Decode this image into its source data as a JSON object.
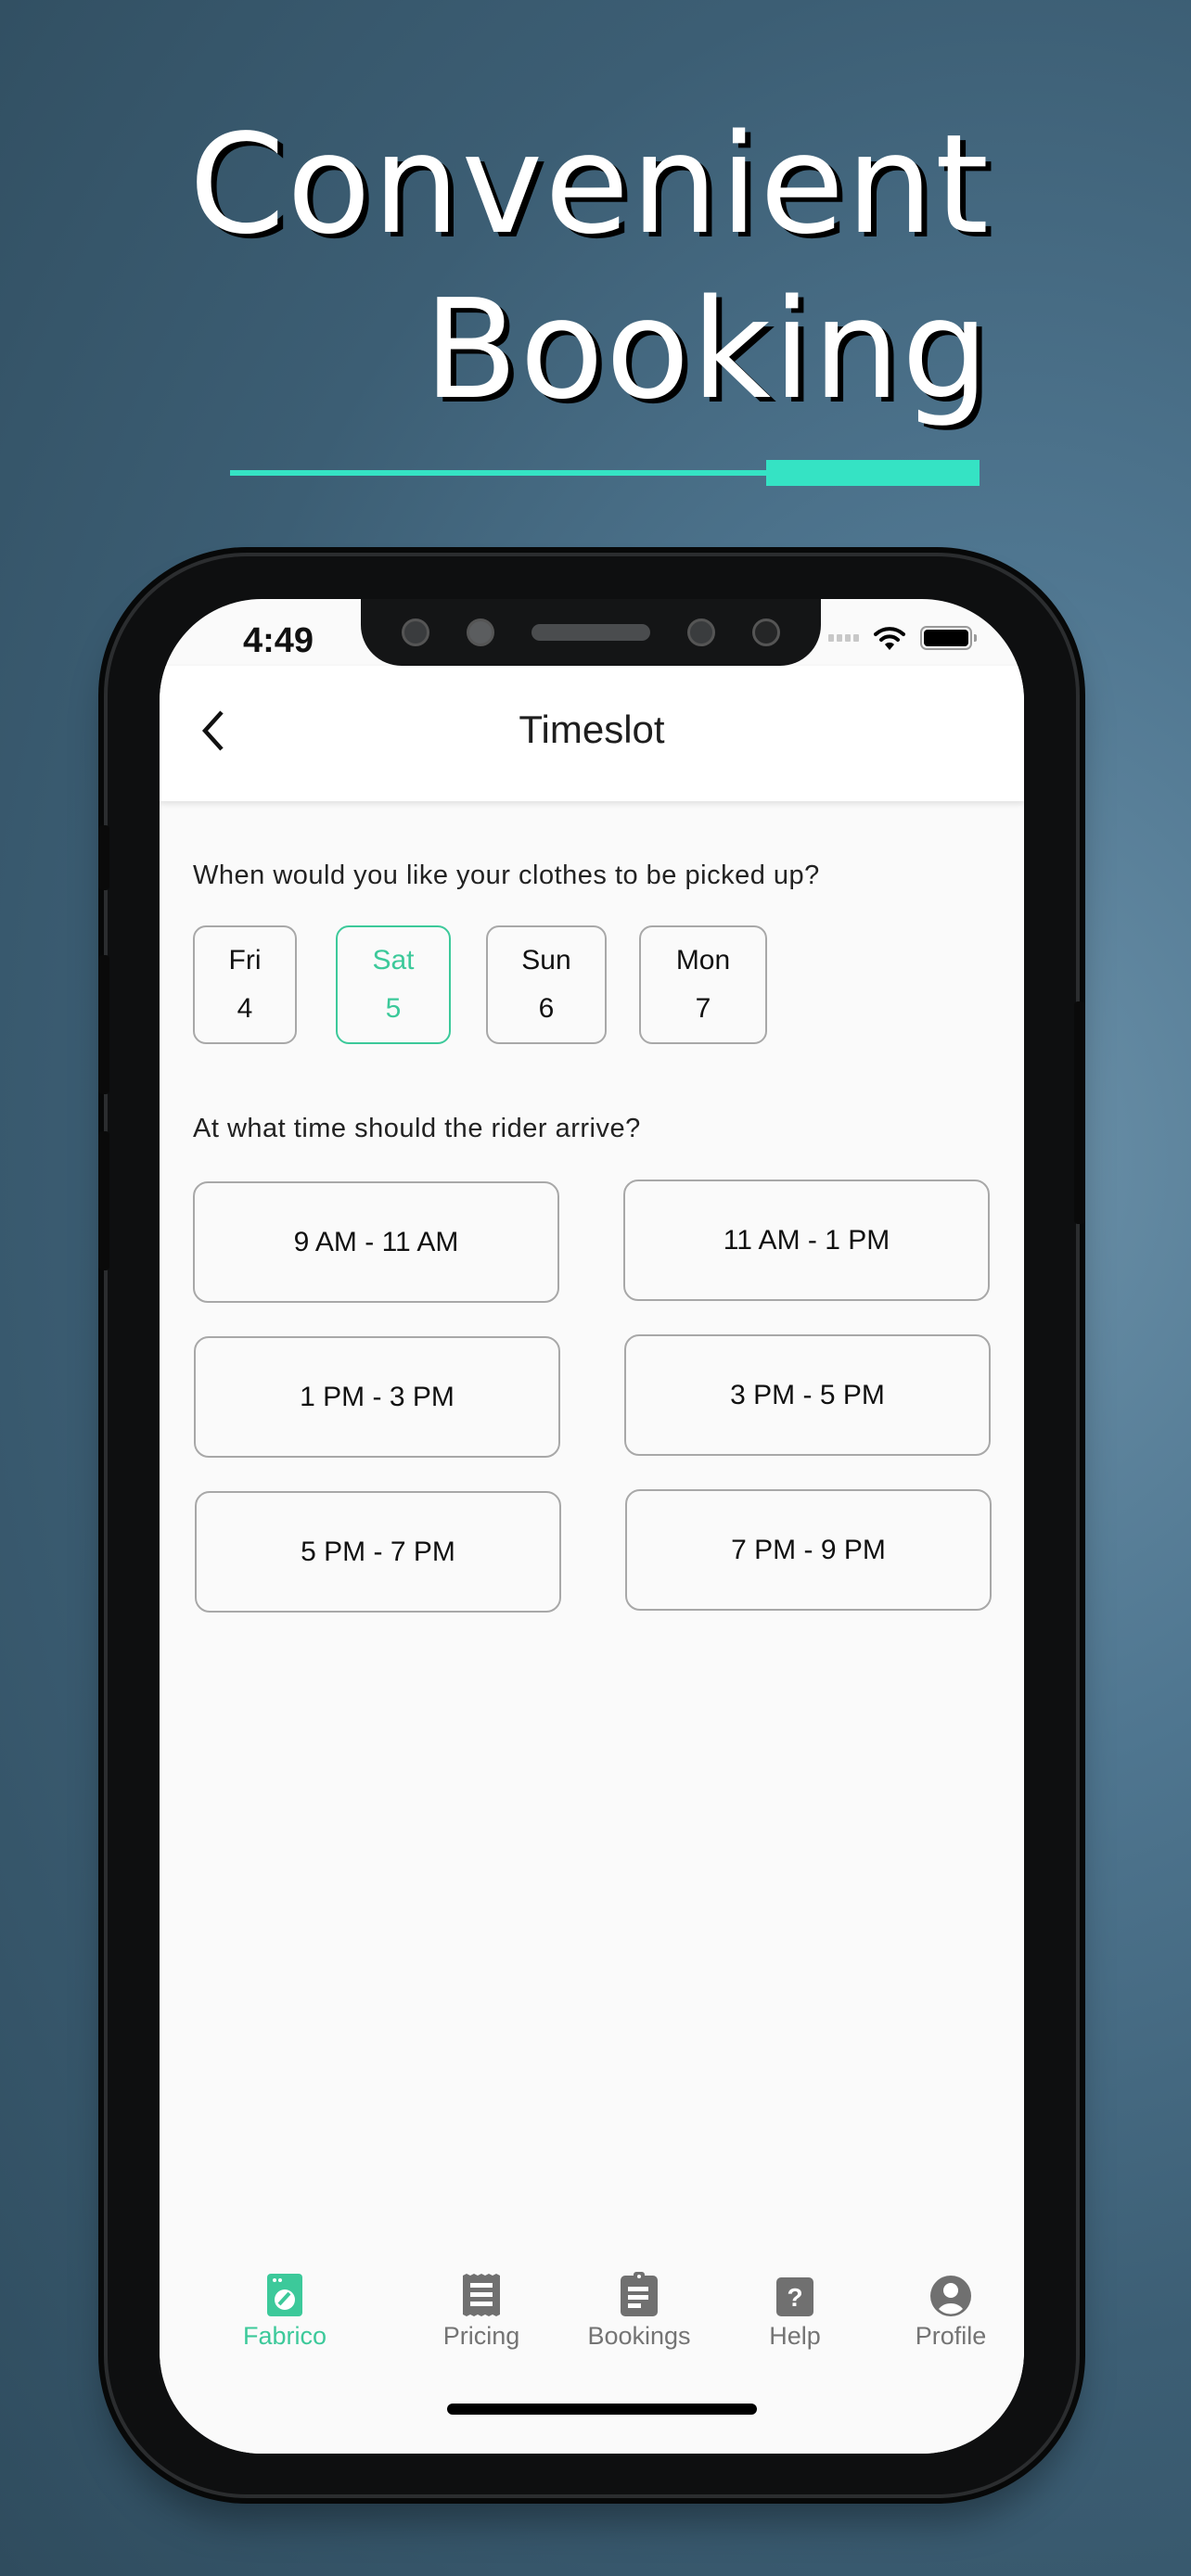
{
  "promo": {
    "headline_line1": "Convenient",
    "headline_line2": "Booking",
    "accent_color": "#35e3c4"
  },
  "status_bar": {
    "time": "4:49",
    "icons": [
      "signal-icon",
      "wifi-icon",
      "battery-icon"
    ]
  },
  "header": {
    "back_icon": "chevron-left-icon",
    "title": "Timeslot"
  },
  "pickup": {
    "question": "When would you like your clothes to be picked up?",
    "selected_index": 1,
    "dates": [
      {
        "day": "Fri",
        "date": "4",
        "selected": false
      },
      {
        "day": "Sat",
        "date": "5",
        "selected": true
      },
      {
        "day": "Sun",
        "date": "6",
        "selected": false
      },
      {
        "day": "Mon",
        "date": "7",
        "selected": false
      }
    ]
  },
  "arrival": {
    "question": "At what time should the rider arrive?",
    "slots": [
      {
        "label": "9 AM - 11 AM"
      },
      {
        "label": "11 AM - 1 PM"
      },
      {
        "label": "1 PM - 3 PM"
      },
      {
        "label": "3 PM - 5 PM"
      },
      {
        "label": "5 PM - 7 PM"
      },
      {
        "label": "7 PM - 9 PM"
      }
    ]
  },
  "tabbar": {
    "active_color": "#3cc99a",
    "inactive_color": "#747474",
    "items": [
      {
        "label": "Fabrico",
        "icon": "washing-machine-icon",
        "active": true
      },
      {
        "label": "Pricing",
        "icon": "receipt-icon",
        "active": false
      },
      {
        "label": "Bookings",
        "icon": "clipboard-icon",
        "active": false
      },
      {
        "label": "Help",
        "icon": "help-icon",
        "active": false
      },
      {
        "label": "Profile",
        "icon": "profile-icon",
        "active": false
      }
    ]
  }
}
